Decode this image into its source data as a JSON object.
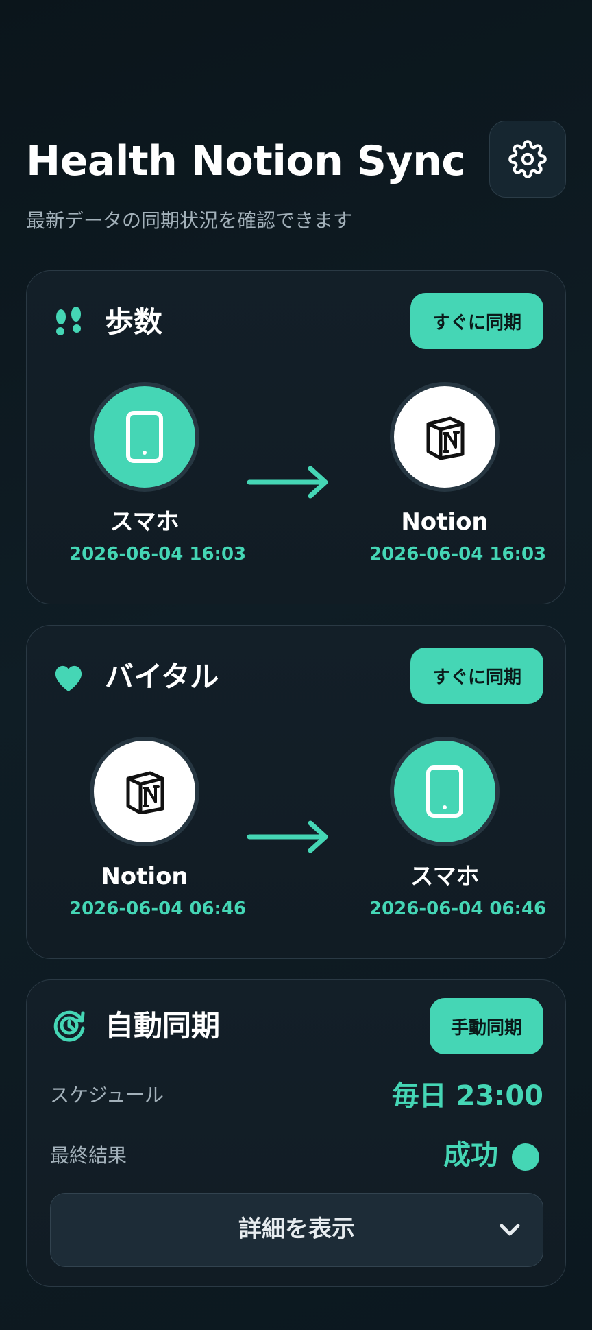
{
  "header": {
    "title": "Health Notion Sync",
    "subtitle": "最新データの同期状況を確認できます",
    "settings_icon": "gear-icon"
  },
  "steps_card": {
    "icon": "footprints-icon",
    "title": "歩数",
    "sync_button": "すぐに同期",
    "source": {
      "icon": "phone-icon",
      "label": "スマホ",
      "time": "2026-06-04 16:03"
    },
    "target": {
      "icon": "notion-icon",
      "label": "Notion",
      "time": "2026-06-04 16:03"
    }
  },
  "vital_card": {
    "icon": "heart-icon",
    "title": "バイタル",
    "sync_button": "すぐに同期",
    "source": {
      "icon": "notion-icon",
      "label": "Notion",
      "time": "2026-06-04 06:46"
    },
    "target": {
      "icon": "phone-icon",
      "label": "スマホ",
      "time": "2026-06-04 06:46"
    }
  },
  "auto_card": {
    "icon": "sync-clock-icon",
    "title": "自動同期",
    "manual_button": "手動同期",
    "schedule_label": "スケジュール",
    "schedule_value": "毎日 23:00",
    "result_label": "最終結果",
    "result_value": "成功",
    "details_button": "詳細を表示",
    "details_icon": "chevron-down-icon"
  },
  "colors": {
    "accent": "#45d6b5",
    "background": "#0d1a21",
    "card": "#121e27",
    "muted_text": "#a3b1ba"
  }
}
